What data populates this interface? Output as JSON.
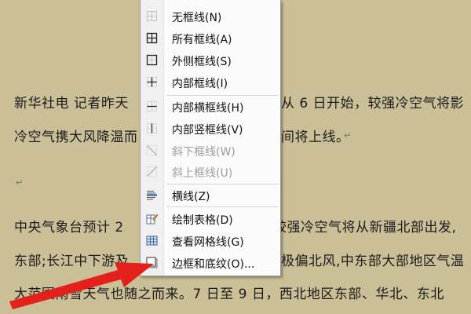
{
  "document": {
    "lines": [
      "新华社电 记者昨天",
      "从 6 日开始，较强冷空气将影",
      "冷空气携大风降温而",
      "间将上线。",
      "中央气象台预计 2 ",
      "较强冷空气将从新疆北部出发,",
      "东部;长江中下游及",
      "极偏北风,中东部大部地区气温",
      "大范围雨雪天气也随之而来。7 日至 9 日，西北地区东部、华北、东北"
    ],
    "para_mark": "↵"
  },
  "menu": {
    "items": [
      {
        "label": "无框线(N)",
        "icon": "no-border-icon",
        "disabled": false
      },
      {
        "label": "所有框线(A)",
        "icon": "all-borders-icon",
        "disabled": false
      },
      {
        "label": "外侧框线(S)",
        "icon": "outside-borders-icon",
        "disabled": false
      },
      {
        "label": "内部框线(I)",
        "icon": "inside-borders-icon",
        "disabled": false
      },
      {
        "label": "内部横框线(H)",
        "icon": "inside-horizontal-border-icon",
        "disabled": false
      },
      {
        "label": "内部竖框线(V)",
        "icon": "inside-vertical-border-icon",
        "disabled": false
      },
      {
        "label": "斜下框线(W)",
        "icon": "diagonal-down-border-icon",
        "disabled": true
      },
      {
        "label": "斜上框线(U)",
        "icon": "diagonal-up-border-icon",
        "disabled": true
      },
      {
        "label": "横线(Z)",
        "icon": "horizontal-line-icon",
        "disabled": false
      },
      {
        "label": "绘制表格(D)",
        "icon": "draw-table-icon",
        "disabled": false
      },
      {
        "label": "查看网格线(G)",
        "icon": "view-gridlines-icon",
        "disabled": false
      },
      {
        "label": "边框和底纹(O)...",
        "icon": "borders-shading-icon",
        "disabled": false
      }
    ]
  },
  "colors": {
    "background": "#cbbf97",
    "arrow": "#e3201b",
    "menu": "#fbfbfb"
  }
}
